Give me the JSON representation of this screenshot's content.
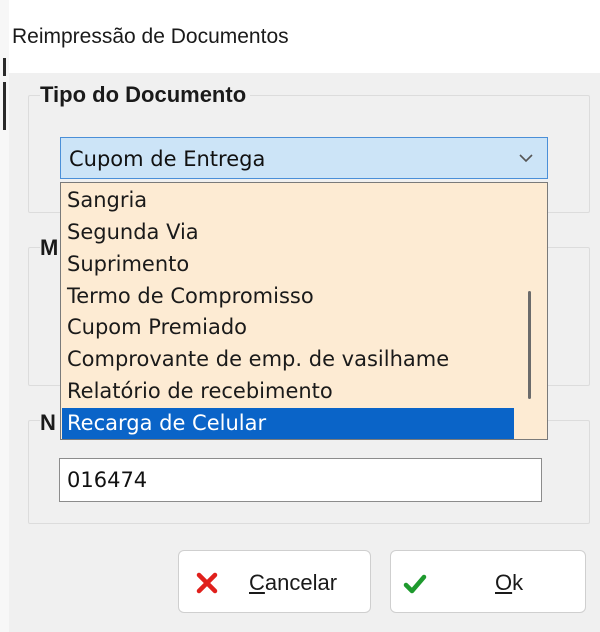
{
  "window": {
    "title": "Reimpressão de Documentos"
  },
  "tipo_documento": {
    "label": "Tipo do Documento",
    "selected_value": "Cupom de Entrega",
    "options": [
      "Sangria",
      "Segunda Via",
      "Suprimento",
      "Termo de Compromisso",
      "Cupom Premiado",
      "Comprovante de emp. de vasilhame",
      "Relatório de recebimento",
      "Recarga de Celular"
    ],
    "highlighted_option": "Recarga de Celular"
  },
  "hidden_group_labels": {
    "second": "M",
    "third": "N"
  },
  "numero": {
    "value": "016474"
  },
  "buttons": {
    "cancel": {
      "mnemonic": "C",
      "rest": "ancelar"
    },
    "ok": {
      "mnemonic": "O",
      "rest": "k"
    }
  },
  "colors": {
    "combo_bg": "#cce4f7",
    "list_bg": "#fdebd3",
    "selection": "#0a64c8",
    "cancel_icon": "#e0201c",
    "ok_icon": "#1e9a2e"
  },
  "icons": {
    "dropdown": "chevron-down-icon",
    "cancel": "red-x-icon",
    "ok": "green-check-icon"
  }
}
